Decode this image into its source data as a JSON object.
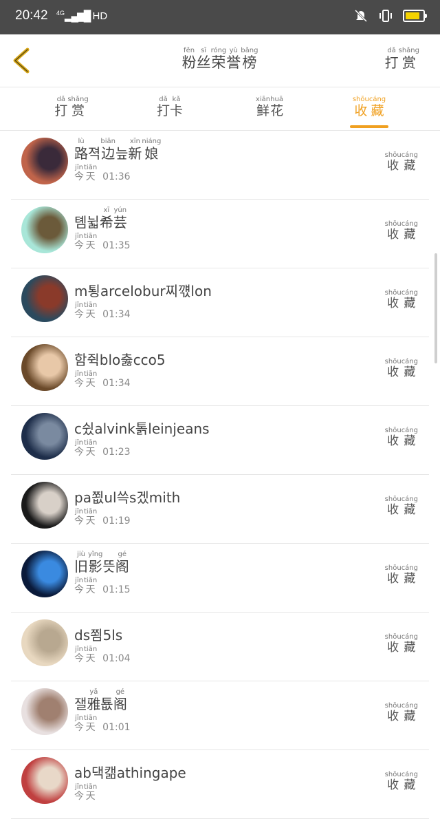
{
  "status_bar": {
    "time": "20:42",
    "network": "4G",
    "hd": "HD"
  },
  "header": {
    "title": [
      {
        "py": "fěn",
        "hz": "粉"
      },
      {
        "py": "sī",
        "hz": "丝"
      },
      {
        "py": "róng",
        "hz": "荣"
      },
      {
        "py": "yù",
        "hz": "誉"
      },
      {
        "py": "bǎng",
        "hz": "榜"
      }
    ],
    "right": [
      {
        "py": "dǎ",
        "hz": "打"
      },
      {
        "py": "shǎng",
        "hz": "赏"
      }
    ]
  },
  "tabs": [
    {
      "chars": [
        {
          "py": "dǎ",
          "hz": "打"
        },
        {
          "py": "shǎng",
          "hz": "赏"
        }
      ],
      "active": false
    },
    {
      "chars": [
        {
          "py": "dǎ",
          "hz": "打"
        },
        {
          "py": "kǎ",
          "hz": "卡"
        }
      ],
      "active": false
    },
    {
      "chars": [
        {
          "py": "xiān",
          "hz": "鲜"
        },
        {
          "py": "huā",
          "hz": "花"
        }
      ],
      "active": false
    },
    {
      "chars": [
        {
          "py": "shōu",
          "hz": "收"
        },
        {
          "py": "cáng",
          "hz": "藏"
        }
      ],
      "active": true
    }
  ],
  "today": [
    {
      "py": "jīn",
      "hz": "今"
    },
    {
      "py": "tiān",
      "hz": "天"
    }
  ],
  "action": [
    {
      "py": "shōu",
      "hz": "收"
    },
    {
      "py": "cáng",
      "hz": "藏"
    }
  ],
  "rows": [
    {
      "name": [
        {
          "py": "lù",
          "hz": "路"
        },
        {
          "py": "",
          "hz": "젹"
        },
        {
          "py": "biān",
          "hz": "边"
        },
        {
          "py": "",
          "hz": "늪"
        },
        {
          "py": "xīn",
          "hz": "新"
        },
        {
          "py": "niáng",
          "hz": "娘"
        }
      ],
      "time": "01:36"
    },
    {
      "name": [
        {
          "py": "",
          "hz": "톔"
        },
        {
          "py": "",
          "hz": "뉣"
        },
        {
          "py": "xī",
          "hz": "希"
        },
        {
          "py": "yún",
          "hz": "芸"
        }
      ],
      "time": "01:35"
    },
    {
      "name": [
        {
          "py": "",
          "hz": "m툉arcelobur찌꺣lon"
        }
      ],
      "time": "01:34"
    },
    {
      "name": [
        {
          "py": "",
          "hz": "함쥑blo춣cco5"
        }
      ],
      "time": "01:34"
    },
    {
      "name": [
        {
          "py": "",
          "hz": "c슀alvink톩leinjeans"
        }
      ],
      "time": "01:23"
    },
    {
      "name": [
        {
          "py": "",
          "hz": "pa쬢ul쓱s겠mith"
        }
      ],
      "time": "01:19"
    },
    {
      "name": [
        {
          "py": "jiù",
          "hz": "旧"
        },
        {
          "py": "yǐng",
          "hz": "影"
        },
        {
          "py": "",
          "hz": "뜻"
        },
        {
          "py": "gé",
          "hz": "阁"
        }
      ],
      "time": "01:15"
    },
    {
      "name": [
        {
          "py": "",
          "hz": "ds쬠5ls"
        }
      ],
      "time": "01:04"
    },
    {
      "name": [
        {
          "py": "",
          "hz": "잴"
        },
        {
          "py": "yǎ",
          "hz": "雅"
        },
        {
          "py": "",
          "hz": "툢"
        },
        {
          "py": "gé",
          "hz": "阁"
        }
      ],
      "time": "01:01"
    },
    {
      "name": [
        {
          "py": "",
          "hz": "ab댁캚athingape"
        }
      ],
      "time": ""
    }
  ],
  "avatar_colors": [
    [
      "#c0644a",
      "#3a2a3a"
    ],
    [
      "#a8e6d8",
      "#6b5a3a"
    ],
    [
      "#2b4a5e",
      "#8a3a2a"
    ],
    [
      "#6b4a2a",
      "#e8c8a8"
    ],
    [
      "#1e2e4a",
      "#7a8aa0"
    ],
    [
      "#1a1a1a",
      "#d8d0c8"
    ],
    [
      "#0a1a3a",
      "#3a8ae0"
    ],
    [
      "#e8d8c0",
      "#b8a890"
    ],
    [
      "#e8e0e0",
      "#a08070"
    ],
    [
      "#c04040",
      "#e8d8c8"
    ]
  ],
  "accent": "#f0a020"
}
